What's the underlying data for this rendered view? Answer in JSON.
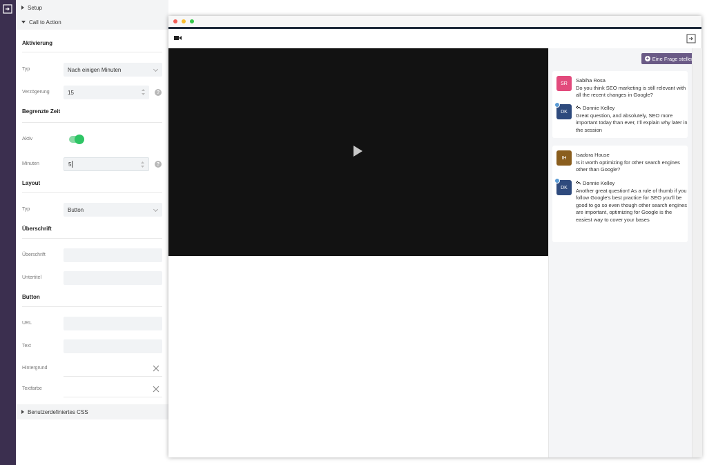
{
  "sidebar": {
    "sections": {
      "setup": "Setup",
      "cta": "Call to Action",
      "css": "Benutzerdefiniertes CSS"
    },
    "activation": {
      "title": "Aktivierung",
      "type_label": "Typ",
      "type_value": "Nach einigen Minuten",
      "delay_label": "Verzögerung",
      "delay_value": "15"
    },
    "limited": {
      "title": "Begrenzte Zeit",
      "active_label": "Aktiv",
      "active_on": true,
      "minutes_label": "Minuten",
      "minutes_value": "5"
    },
    "layout": {
      "title": "Layout",
      "type_label": "Typ",
      "type_value": "Button"
    },
    "heading": {
      "title": "Überschrift",
      "heading_label": "Überschrift",
      "subtitle_label": "Untertitel"
    },
    "button": {
      "title": "Button",
      "url_label": "URL",
      "text_label": "Text",
      "bg_label": "Hintergrund",
      "color_label": "Textfarbe"
    }
  },
  "preview": {
    "ask_button": "Eine Frage stellen",
    "questions": [
      {
        "name": "Sabiha Rosa",
        "initials": "SR",
        "avatar_color": "#e24a7c",
        "text": "Do you think SEO marketing is still relevant with all the recent changes in Google?",
        "reply": {
          "name": "Donnie Kelley",
          "initials": "DK",
          "avatar_color": "#2e4a7d",
          "text": "Great question, and absolutely, SEO more important today than ever, I'll explain why later in the session"
        }
      },
      {
        "name": "Isadora House",
        "initials": "IH",
        "avatar_color": "#8a5e1e",
        "text": "Is it worth optimizing for other search engines other than Google?",
        "reply": {
          "name": "Donnie Kelley",
          "initials": "DK",
          "avatar_color": "#2e4a7d",
          "text": "Another great question! As a rule of thumb if you follow Google's best practice for SEO you'll be good to go so even though other search engines are important, optimizing for Google is the easiest way to cover your bases"
        }
      }
    ]
  },
  "colors": {
    "rail": "#3b2f4f",
    "accent": "#2ec565",
    "ask_button": "#6a5a86"
  },
  "icons": [
    "exit-icon",
    "video-camera-icon",
    "play-icon",
    "help-icon",
    "close-icon",
    "reply-icon",
    "plus-circle-icon"
  ]
}
